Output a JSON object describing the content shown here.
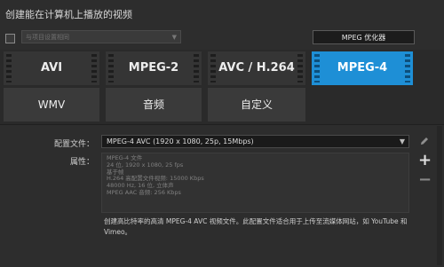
{
  "section_title": "创建能在计算机上播放的视频",
  "preset_dropdown": {
    "value": "与项目设置相同"
  },
  "optimizer_button": "MPEG 优化器",
  "formats_row1": [
    "AVI",
    "MPEG-2",
    "AVC / H.264",
    "MPEG-4"
  ],
  "formats_row2": [
    "WMV",
    "音频",
    "自定义"
  ],
  "selected_format": "MPEG-4",
  "profile_label": "配置文件：",
  "profile_value": "MPEG-4 AVC (1920 x 1080, 25p, 15Mbps)",
  "properties_label": "属性：",
  "properties": [
    "MPEG-4 文件",
    "24 位, 1920 x 1080, 25 fps",
    "基于帧",
    "H.264 高配置文件视频: 15000 Kbps",
    "48000 Hz, 16 位, 立体声",
    "MPEG AAC 音频: 256 Kbps"
  ],
  "description_line1": "创建高比特率的高清 MPEG-4 AVC 视频文件。此配置文件适合用于上传至流媒体网站，如 YouTube 和",
  "description_line2": "Vimeo。",
  "icons": [
    "edit-pencil-icon",
    "add-plus-icon",
    "remove-minus-icon"
  ]
}
